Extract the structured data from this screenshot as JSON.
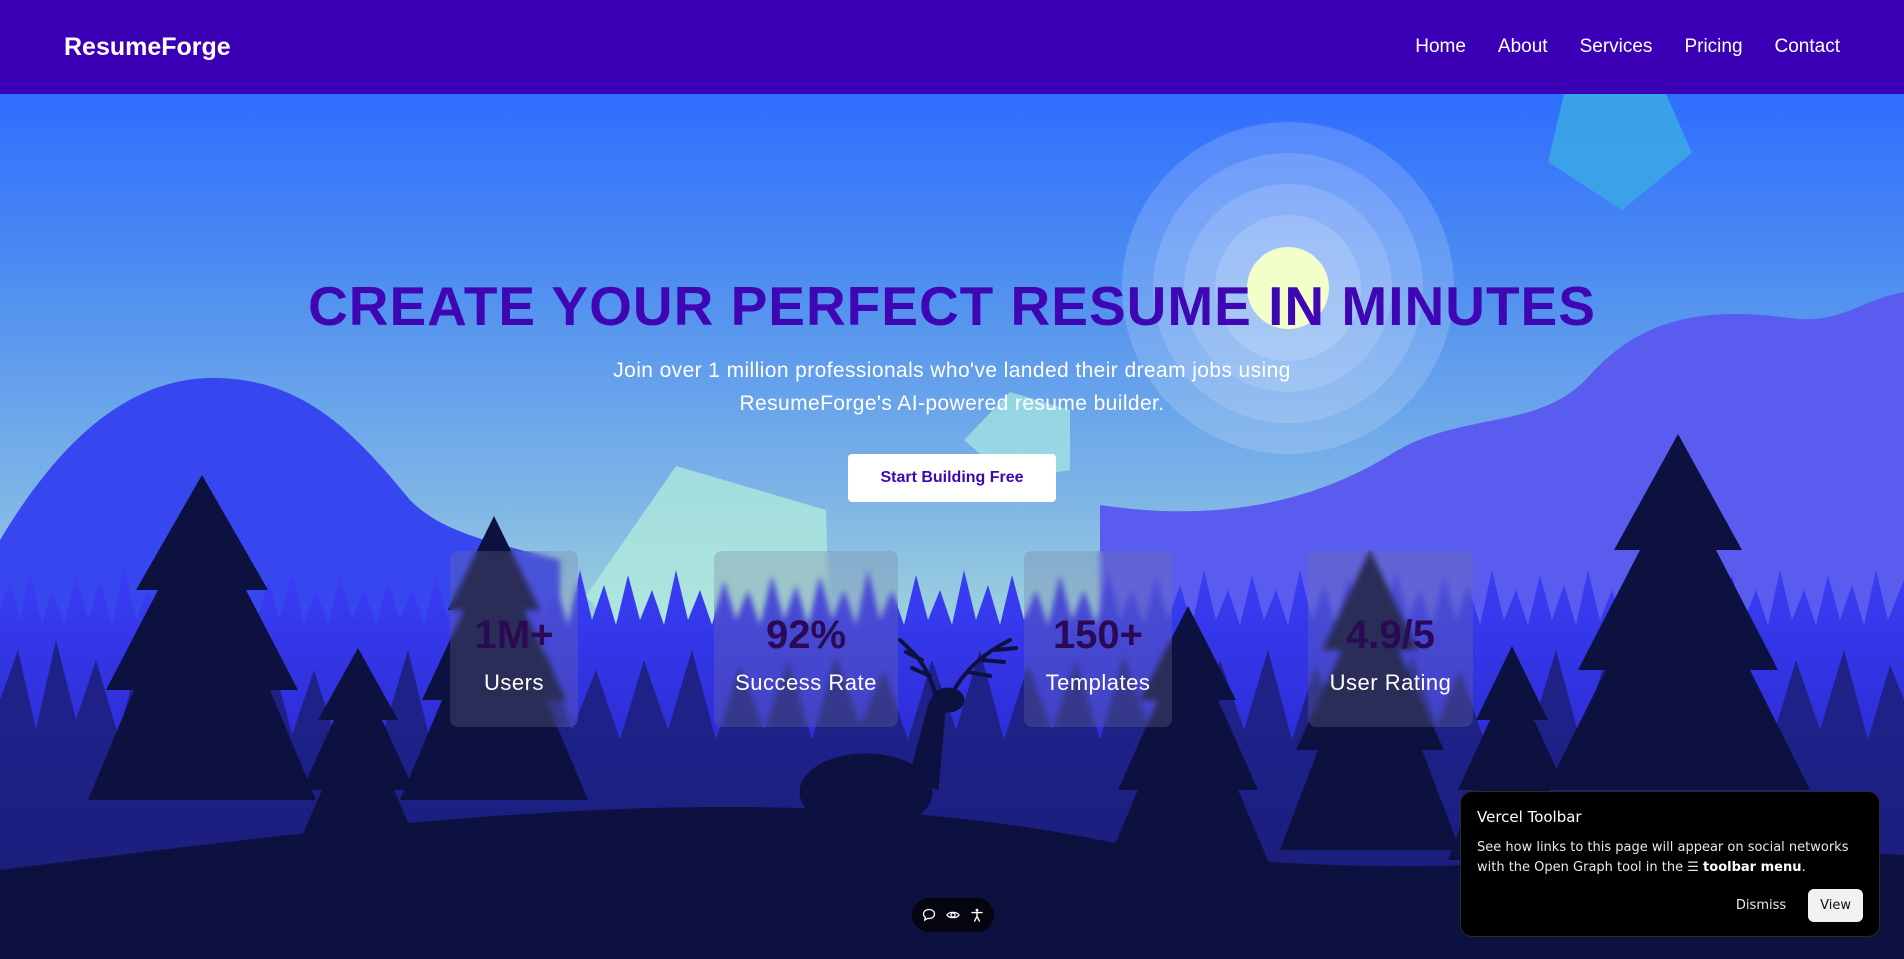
{
  "brand": {
    "name": "ResumeForge"
  },
  "nav": {
    "links": [
      "Home",
      "About",
      "Services",
      "Pricing",
      "Contact"
    ]
  },
  "hero": {
    "headline": "CREATE YOUR PERFECT RESUME IN MINUTES",
    "subtitle": "Join over 1 million professionals who've landed their dream jobs using ResumeForge's AI-powered resume builder.",
    "cta_label": "Start Building Free"
  },
  "stats": [
    {
      "value": "1M+",
      "label": "Users"
    },
    {
      "value": "92%",
      "label": "Success Rate"
    },
    {
      "value": "150+",
      "label": "Templates"
    },
    {
      "value": "4.9/5",
      "label": "User Rating"
    }
  ],
  "mini_toolbar": {
    "icons": [
      "comment-icon",
      "eye-icon",
      "accessibility-icon"
    ]
  },
  "vercel_toolbar": {
    "title": "Vercel Toolbar",
    "text_before": "See how links to this page will appear on social networks with the Open Graph tool in the",
    "menu_glyph": "☰",
    "menu_text": "toolbar menu",
    "text_after": ".",
    "dismiss_label": "Dismiss",
    "view_label": "View"
  },
  "colors": {
    "nav_bg": "#3b00b6",
    "headline": "#3f06b4",
    "tree_dark": "#0d1140",
    "sun": "#f3ffc8"
  }
}
